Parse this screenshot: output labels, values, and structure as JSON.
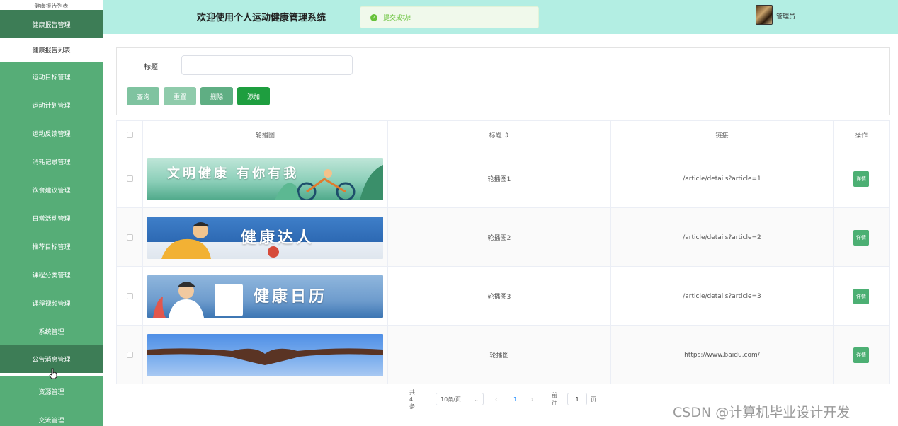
{
  "sidebar": {
    "top_partial": "健康报告列表",
    "items": [
      {
        "label": "健康报告管理"
      },
      {
        "label": "健康报告列表"
      },
      {
        "label": "运动目标管理"
      },
      {
        "label": "运动计划管理"
      },
      {
        "label": "运动反馈管理"
      },
      {
        "label": "消耗记录管理"
      },
      {
        "label": "饮食建议管理"
      },
      {
        "label": "日常活动管理"
      },
      {
        "label": "推荐目标管理"
      },
      {
        "label": "课程分类管理"
      },
      {
        "label": "课程视频管理"
      },
      {
        "label": "系统管理"
      },
      {
        "label": "公告消息管理"
      },
      {
        "label": "资源管理"
      },
      {
        "label": "交流管理"
      }
    ]
  },
  "header": {
    "title": "欢迎使用个人运动健康管理系统",
    "toast": "提交成功!",
    "user": "管理员"
  },
  "search": {
    "label": "标题",
    "placeholder": "",
    "buttons": {
      "query": "查询",
      "reset": "重置",
      "delete": "删除",
      "add": "添加"
    }
  },
  "table": {
    "headers": {
      "image": "轮播图",
      "title": "标题 ⇕",
      "link": "链接",
      "action": "操作"
    },
    "rows": [
      {
        "banner": "文明健康 有你有我",
        "title": "轮播图1",
        "link": "/article/details?article=1",
        "action": "详情"
      },
      {
        "banner": "健康达人",
        "title": "轮播图2",
        "link": "/article/details?article=2",
        "action": "详情"
      },
      {
        "banner": "健康日历",
        "title": "轮播图3",
        "link": "/article/details?article=3",
        "action": "详情"
      },
      {
        "banner": "",
        "title": "轮播图",
        "link": "https://www.baidu.com/",
        "action": "详情"
      }
    ]
  },
  "pagination": {
    "total": "共 4 条",
    "page_size": "10条/页",
    "prev": "‹",
    "current": "1",
    "next": "›",
    "jump_label": "前往",
    "jump_value": "1",
    "jump_unit": "页"
  },
  "watermark": "CSDN @计算机毕业设计开发"
}
